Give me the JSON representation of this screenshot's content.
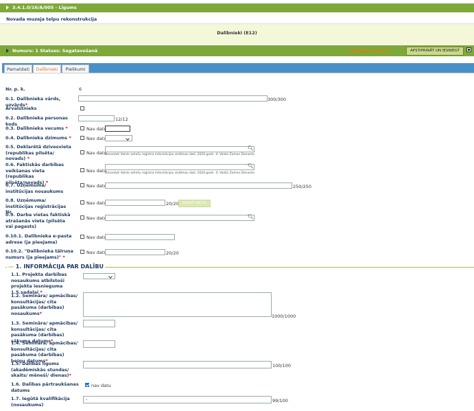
{
  "top_bar": {
    "title": "3.4.1.0/16/A/005 - Līgums"
  },
  "project_title": "Novada muzeja telpu rekonstrukcija",
  "section_header": "Dalībnieki (E12)",
  "status_bar": {
    "text": "Numurs: 1  Statuss: Sagatavošanā",
    "error_text": "[ Kļūdas formā ]",
    "submit_label": "APSTIPRINĀT UN IESNIEGT"
  },
  "tabs": [
    "Pamatdati",
    "Dalībnieki",
    "Pielikumi"
  ],
  "nav_datu": "Nav datu",
  "nav_datu_lower": "nav datu",
  "address_hint": "Izmantoti Valsts adrešu reģistra informācijas sistēmas dati, 2020.gads. © Valsts Zemes Dienests",
  "search_button": "MEKLĒT DATUS",
  "fields": {
    "nr_label": "Nr. p. k.",
    "nr_value": "6",
    "f01": "0.1. Dalībnieka vārds, uzvārds",
    "f01_count": "300/300",
    "foreign": "Ārvalstnieks",
    "f02": "0.2. Dalībnieka personas kods",
    "f02_count": "12/12",
    "f03": "0.3. Dalībnieka vecums",
    "f04": "0.4. Dalībnieka dzimums",
    "f05": "0.5. Deklarētā dzīvesvieta (republikas pilsēta/ novads)",
    "f06": "0.6. Faktiskās darbības veikšanas vieta (republikas pilsēta/novads)",
    "f07": "0.7. Uzņēmuma/ institūcijas nosaukums",
    "f07_count": "250/250",
    "f08": "0.8. Uzņēmuma/ institūcijas reģistrācijas Nr.",
    "f08_count": "20/20",
    "f09": "0.9. Darba vietas faktiskā atrašanās vieta (pilsēta vai pagasts)",
    "f010_1": "0.10.1. Dalībnieka e-pasta adrese (ja pieejama)",
    "f010_2": "0.10.2. \"Dalībnieka tālruņa numurs (ja pieejams)\"",
    "f010_2_count": "20/20"
  },
  "participation": {
    "heading": "1. INFORMĀCIJA PAR DALĪBU",
    "f11": "1.1. Projekta darbības nosaukums atbilstoši projekta iesnieguma 1.5.sadaļai",
    "f12": "1.2. Semināra/ apmācības/ konsultācijas/ cita pasākuma (darbības) nosaukums",
    "f12_count": "1000/1000",
    "f13": "1.3. Semināra/ apmācības/ konsultācijas/ cita pasākuma (darbības) sākuma datums",
    "f14": "1.4. Semināra/ apmācības/ konsultācijas/ cita pasākuma (darbības) beigu datums",
    "f15": "1.5. Dalības līgums (akadēmiskās stundas/ skaits/ mēneši/ dienas)",
    "f15_count": "100/100",
    "f16": "1.6. Dalības pārtraukšanas datums",
    "f17": "1.7. Iegūtā kvalifikācija (nosaukums)",
    "f17_value": "-",
    "f17_count": "99/100"
  },
  "required_mark": "*",
  "colors": {
    "green": "#7ea83a",
    "tab_strip": "#4a90c8",
    "accent_orange": "#d9681a"
  }
}
